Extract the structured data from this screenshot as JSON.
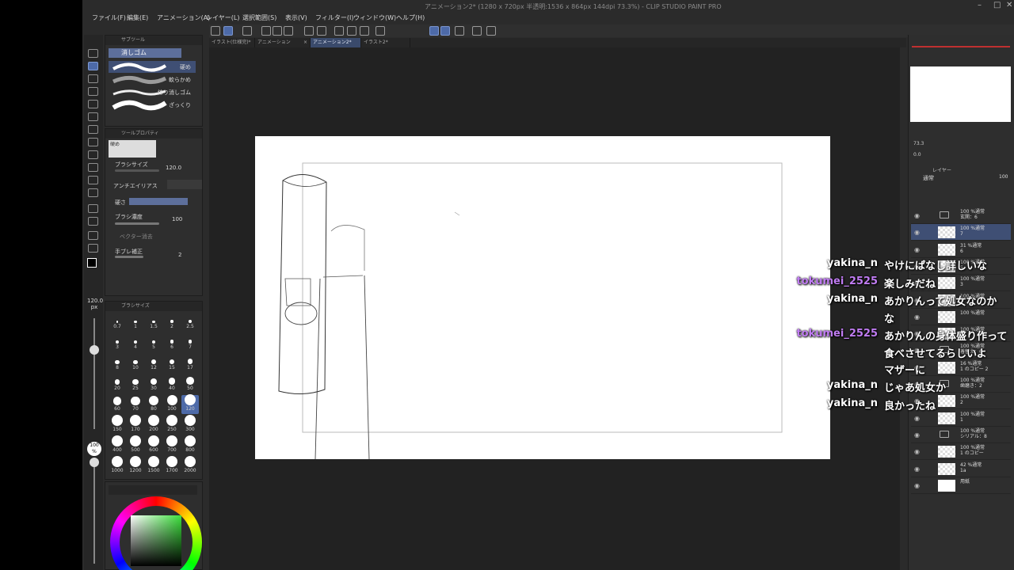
{
  "window": {
    "title": "アニメーション2* (1280 x 720px 半透明:1536 x 864px 144dpi 73.3%) - CLIP STUDIO PAINT PRO"
  },
  "menu": [
    "ファイル(F)",
    "編集(E)",
    "アニメーション(A)",
    "レイヤー(L)",
    "選択範囲(S)",
    "表示(V)",
    "フィルター(I)",
    "ウィンドウ(W)",
    "ヘルプ(H)"
  ],
  "tabs": [
    {
      "label": "イラスト(仕様完)*",
      "active": false
    },
    {
      "label": "アニメーション",
      "active": false
    },
    {
      "label": "アニメーション2*",
      "active": true
    },
    {
      "label": "イラスト2*",
      "active": false
    }
  ],
  "subtool": {
    "header": "サブツール",
    "group": "消しゴム",
    "items": [
      "硬め",
      "軟らかめ",
      "練り消しゴム",
      "ざっくり"
    ]
  },
  "toolprop": {
    "header": "ツールプロパティ",
    "tool_name": "硬め",
    "brush_size_label": "ブラシサイズ",
    "brush_size_value": "120.0",
    "antialias_label": "アンチエイリアス",
    "hardness_label": "硬さ",
    "density_label": "ブラシ濃度",
    "density_value": "100",
    "vector_label": "ベクター消去",
    "stabilizer_label": "手ブレ補正",
    "stabilizer_value": "2"
  },
  "brushsize": {
    "header": "ブラシサイズ",
    "sizes": [
      "0.7",
      "1",
      "1.5",
      "2",
      "2.5",
      "3",
      "4",
      "5",
      "6",
      "7",
      "8",
      "10",
      "12",
      "15",
      "17",
      "20",
      "25",
      "30",
      "40",
      "50",
      "60",
      "70",
      "80",
      "100",
      "120",
      "150",
      "170",
      "200",
      "250",
      "300",
      "400",
      "500",
      "600",
      "700",
      "800",
      "1000",
      "1200",
      "1500",
      "1700",
      "2000"
    ],
    "selected": "120"
  },
  "left_strip": {
    "size_value": "120.0",
    "size_unit": "px",
    "opacity_value": "100",
    "opacity_unit": "%"
  },
  "navigator": {
    "zoom": "73.3",
    "angle": "0.0"
  },
  "layers": {
    "header": "レイヤー",
    "blend": "通常",
    "opacity": "100",
    "items": [
      {
        "line1": "100 %通常",
        "line2": "玄関：6",
        "type": "folder",
        "selected": false
      },
      {
        "line1": "100 %通常",
        "line2": "7",
        "type": "layer",
        "selected": true
      },
      {
        "line1": "31 %通常",
        "line2": "6",
        "type": "layer",
        "selected": false
      },
      {
        "line1": "100 %通常",
        "line2": "5",
        "type": "layer",
        "selected": false
      },
      {
        "line1": "100 %通常",
        "line2": "3",
        "type": "layer",
        "selected": false
      },
      {
        "line1": "100 %通常",
        "line2": "1",
        "type": "layer",
        "selected": false
      },
      {
        "line1": "100 %通常",
        "line2": "",
        "type": "layer",
        "selected": false
      },
      {
        "line1": "100 %通常",
        "line2": "",
        "type": "layer",
        "selected": false
      },
      {
        "line1": "100 %通常",
        "line2": "着替え：6",
        "type": "folder",
        "selected": false
      },
      {
        "line1": "16 %通常",
        "line2": "1 のコピー 2",
        "type": "layer",
        "selected": false
      },
      {
        "line1": "100 %通常",
        "line2": "歯磨き：2",
        "type": "folder",
        "selected": false
      },
      {
        "line1": "100 %通常",
        "line2": "2",
        "type": "layer",
        "selected": false
      },
      {
        "line1": "100 %通常",
        "line2": "1",
        "type": "layer",
        "selected": false
      },
      {
        "line1": "100 %通常",
        "line2": "シリアル：8",
        "type": "folder",
        "selected": false
      },
      {
        "line1": "100 %通常",
        "line2": "1 のコピー",
        "type": "layer",
        "selected": false
      },
      {
        "line1": "42 %通常",
        "line2": "1a",
        "type": "layer",
        "selected": false
      },
      {
        "line1": "用紙",
        "line2": "",
        "type": "paper",
        "selected": false
      }
    ]
  },
  "chat": [
    {
      "user": "yakina_n",
      "user_color": "#ffffff",
      "text": [
        "やけにぱなし詳しいな"
      ]
    },
    {
      "user": "tokumei_2525",
      "user_color": "#c07cf2",
      "text": [
        "楽しみだね"
      ]
    },
    {
      "user": "yakina_n",
      "user_color": "#ffffff",
      "text": [
        "あかりんって処女なのか",
        "な"
      ]
    },
    {
      "user": "tokumei_2525",
      "user_color": "#c07cf2",
      "text": [
        "あかりんの身体盛り作って",
        "食べさせてるらしいよ",
        "マザーに"
      ]
    },
    {
      "user": "yakina_n",
      "user_color": "#ffffff",
      "text": [
        "じゃあ処女か"
      ]
    },
    {
      "user": "yakina_n",
      "user_color": "#ffffff",
      "text": [
        "良かったね"
      ]
    }
  ],
  "colors": {
    "app_bg": "#2b2b2b",
    "panel_bg": "#2e2e2e",
    "accent": "#4d6aa8",
    "chat_user_purple": "#c07cf2"
  }
}
